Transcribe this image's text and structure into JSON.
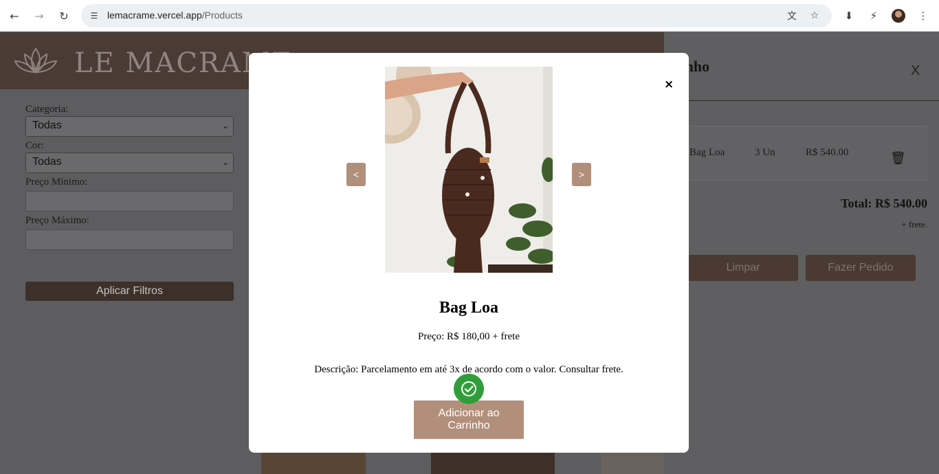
{
  "browser": {
    "url_host": "lemacrame.vercel.app",
    "url_path": "/Products"
  },
  "site": {
    "logo_text": "LE MACRAME"
  },
  "filters": {
    "category_label": "Categoria:",
    "category_value": "Todas",
    "color_label": "Cor:",
    "color_value": "Todas",
    "min_price_label": "Preço Mínimo:",
    "max_price_label": "Preço Máximo:",
    "apply_label": "Aplicar Filtros"
  },
  "cart": {
    "title": "arrinho",
    "close_label": "X",
    "items": [
      {
        "name": "Bag Loa",
        "quantity": "3 Un",
        "price": "R$ 540.00"
      }
    ],
    "total": "Total: R$ 540.00",
    "shipping_note": "+ frete.",
    "clear_label": "Limpar",
    "order_label": "Fazer Pedido"
  },
  "modal": {
    "close_label": "×",
    "prev_label": "<",
    "next_label": ">",
    "product_name": "Bag Loa",
    "price_text": "Preço: R$ 180,00 + frete",
    "description_text": "Descrição: Parcelamento em até 3x de acordo com o valor. Consultar frete.",
    "add_button_label": "Adicionar ao Carrinho"
  },
  "colors": {
    "accent": "#b28f7b",
    "header_brown": "#4a3b34",
    "success_green": "#2f9e3a"
  }
}
